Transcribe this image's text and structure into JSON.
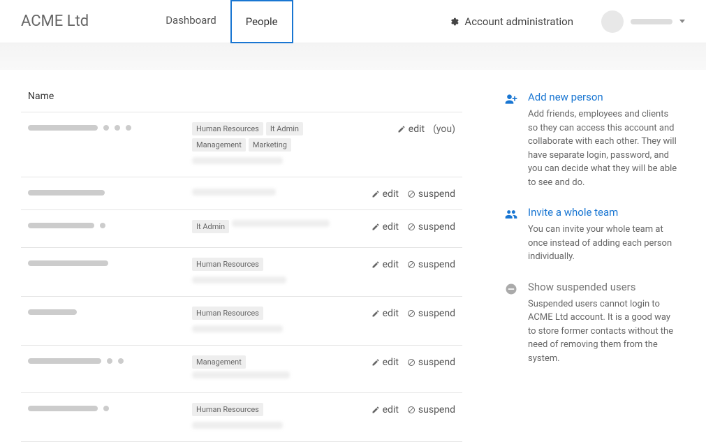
{
  "header": {
    "brand": "ACME Ltd",
    "nav": {
      "dashboard": "Dashboard",
      "people": "People"
    },
    "account_admin": "Account administration"
  },
  "table": {
    "header_name": "Name",
    "rows": [
      {
        "tags": [
          "Human Resources",
          "It Admin",
          "Management",
          "Marketing"
        ],
        "edit": "edit",
        "you": "(you)",
        "email_width": 130,
        "name_width": 100,
        "dots": 3
      },
      {
        "tags": [],
        "edit": "edit",
        "suspend": "suspend",
        "email_width": 120,
        "name_width": 110,
        "dots": 0
      },
      {
        "tags": [
          "It Admin"
        ],
        "edit": "edit",
        "suspend": "suspend",
        "email_width": 140,
        "name_width": 95,
        "dots": 1,
        "email_inline": true
      },
      {
        "tags": [
          "Human Resources"
        ],
        "edit": "edit",
        "suspend": "suspend",
        "email_width": 135,
        "name_width": 115,
        "dots": 0
      },
      {
        "tags": [
          "Human Resources"
        ],
        "edit": "edit",
        "suspend": "suspend",
        "email_width": 130,
        "name_width": 70,
        "dots": 0
      },
      {
        "tags": [
          "Management"
        ],
        "edit": "edit",
        "suspend": "suspend",
        "email_width": 140,
        "name_width": 105,
        "dots": 2,
        "email_inline": true
      },
      {
        "tags": [
          "Human Resources"
        ],
        "edit": "edit",
        "suspend": "suspend",
        "email_width": 130,
        "name_width": 100,
        "dots": 1
      }
    ]
  },
  "sidebar": {
    "add_person": {
      "title": "Add new person",
      "desc": "Add friends, employees and clients so they can access this account and collaborate with each other. They will have separate login, password, and you can decide what they will be able to see and do."
    },
    "invite_team": {
      "title": "Invite a whole team",
      "desc": "You can invite your whole team at once instead of adding each person individually."
    },
    "suspended": {
      "title": "Show suspended users",
      "desc": "Suspended users cannot login to ACME Ltd account. It is a good way to store former contacts without the need of removing them from the system."
    }
  }
}
